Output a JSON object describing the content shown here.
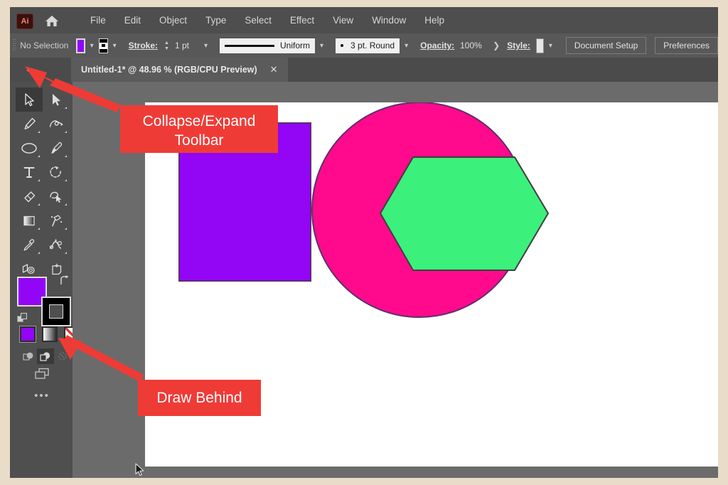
{
  "app": {
    "name": "Adobe Illustrator",
    "logo_text": "Ai",
    "home_icon": "home-icon"
  },
  "menubar": {
    "items": [
      {
        "label": "File"
      },
      {
        "label": "Edit"
      },
      {
        "label": "Object"
      },
      {
        "label": "Type"
      },
      {
        "label": "Select"
      },
      {
        "label": "Effect"
      },
      {
        "label": "View"
      },
      {
        "label": "Window"
      },
      {
        "label": "Help"
      }
    ]
  },
  "control_bar": {
    "selection_status": "No Selection",
    "fill_color": "#9205f5",
    "stroke_color": "#000000",
    "stroke_label": "Stroke:",
    "stroke_weight": "1 pt",
    "stroke_profile": "Uniform",
    "brush_definition": "3 pt. Round",
    "opacity_label": "Opacity:",
    "opacity_value": "100%",
    "style_label": "Style:",
    "style_swatch": "#e6e6e6",
    "document_setup_button": "Document Setup",
    "preferences_button": "Preferences",
    "caret_icon": "chevron-down-icon",
    "more_icon": "chevron-right-icon"
  },
  "tab_bar": {
    "collapse_icon": "double-chevron-left-icon",
    "document_tab": "Untitled-1* @ 48.96 % (RGB/CPU Preview)",
    "close_icon": "close-icon"
  },
  "toolbar": {
    "tools": [
      {
        "name": "selection-tool",
        "selected": true,
        "has_flyout": false
      },
      {
        "name": "direct-selection-tool",
        "selected": false,
        "has_flyout": true
      },
      {
        "name": "pen-tool",
        "selected": false,
        "has_flyout": true
      },
      {
        "name": "curvature-tool",
        "selected": false,
        "has_flyout": true
      },
      {
        "name": "ellipse-tool",
        "selected": false,
        "has_flyout": true
      },
      {
        "name": "paintbrush-tool",
        "selected": false,
        "has_flyout": true
      },
      {
        "name": "type-tool",
        "selected": false,
        "has_flyout": true
      },
      {
        "name": "rotate-tool",
        "selected": false,
        "has_flyout": true
      },
      {
        "name": "eraser-tool",
        "selected": false,
        "has_flyout": true
      },
      {
        "name": "shape-builder-tool",
        "selected": false,
        "has_flyout": true
      },
      {
        "name": "gradient-tool",
        "selected": false,
        "has_flyout": true
      },
      {
        "name": "symbol-sprayer-tool",
        "selected": false,
        "has_flyout": true
      },
      {
        "name": "eyedropper-tool",
        "selected": false,
        "has_flyout": true
      },
      {
        "name": "blend-tool",
        "selected": false,
        "has_flyout": true
      },
      {
        "name": "perspective-grid-tool",
        "selected": false,
        "has_flyout": true
      },
      {
        "name": "artboard-tool",
        "selected": false,
        "has_flyout": false
      },
      {
        "name": "zoom-tool",
        "selected": false,
        "has_flyout": true
      }
    ],
    "fill_swatch_color": "#9205f5",
    "stroke_swatch_color": "#000000",
    "swap_icon": "swap-fill-stroke-icon",
    "default_icon": "default-fill-stroke-icon",
    "fill_types": [
      {
        "name": "color-fill-button",
        "selected": true,
        "color": "#9205f5"
      },
      {
        "name": "gradient-fill-button",
        "selected": false,
        "color": "gradient"
      },
      {
        "name": "none-fill-button",
        "selected": false,
        "color": "none"
      }
    ],
    "draw_modes": [
      {
        "name": "draw-normal-button",
        "active": false,
        "disabled": false
      },
      {
        "name": "draw-behind-button",
        "active": true,
        "disabled": false
      },
      {
        "name": "draw-inside-button",
        "active": false,
        "disabled": true
      }
    ],
    "screen_mode_icon": "change-screen-mode-icon",
    "more_tools_label": "•••"
  },
  "canvas": {
    "background": "#ffffff",
    "shapes": [
      {
        "name": "purple-rectangle",
        "type": "rect",
        "fill": "#9205f5",
        "stroke": "#5a2c6b",
        "z": 1
      },
      {
        "name": "pink-circle",
        "type": "circle",
        "fill": "#ff0a8c",
        "stroke": "#5a2c6b",
        "z": 2
      },
      {
        "name": "green-hexagon",
        "type": "hexagon",
        "fill": "#3cf07c",
        "stroke": "#3f3f3f",
        "z": 3
      }
    ],
    "cursor_icon": "mouse-pointer-icon"
  },
  "annotations": {
    "accent_color": "#ef3b36",
    "callouts": [
      {
        "name": "collapse-expand-toolbar-callout",
        "text": "Collapse/Expand Toolbar"
      },
      {
        "name": "draw-behind-callout",
        "text": "Draw Behind"
      }
    ]
  }
}
